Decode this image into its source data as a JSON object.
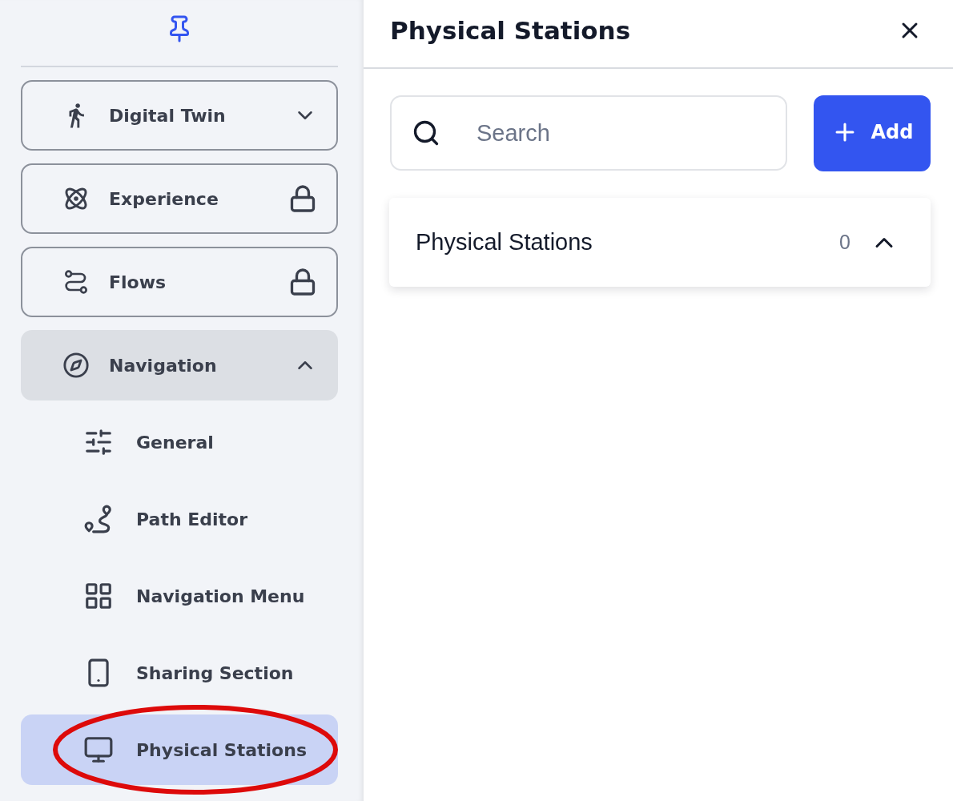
{
  "sidebar": {
    "items": [
      {
        "label": "Digital Twin",
        "kind": "expandable",
        "expanded": false
      },
      {
        "label": "Experience",
        "kind": "locked"
      },
      {
        "label": "Flows",
        "kind": "locked"
      },
      {
        "label": "Navigation",
        "kind": "expandable",
        "expanded": true,
        "children": [
          {
            "label": "General",
            "selected": false,
            "circled": false
          },
          {
            "label": "Path Editor",
            "selected": false,
            "circled": false
          },
          {
            "label": "Navigation Menu",
            "selected": false,
            "circled": false
          },
          {
            "label": "Sharing Section",
            "selected": false,
            "circled": false
          },
          {
            "label": "Physical Stations",
            "selected": true,
            "circled": true
          }
        ]
      }
    ]
  },
  "panel": {
    "title": "Physical Stations",
    "search": {
      "placeholder": "Search"
    },
    "add_button": {
      "label": "Add"
    },
    "sections": [
      {
        "title": "Physical Stations",
        "count": "0",
        "expanded": true
      }
    ]
  }
}
